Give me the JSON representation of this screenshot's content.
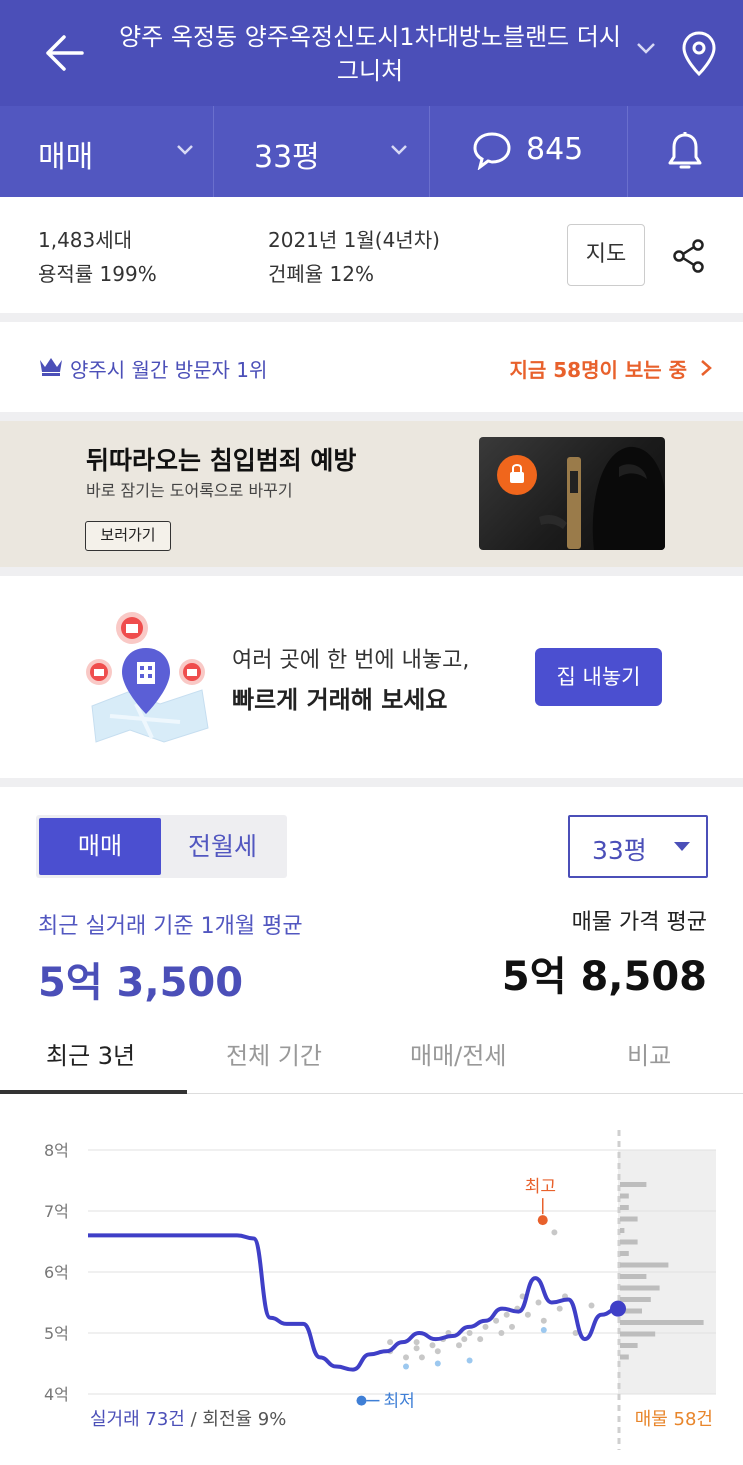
{
  "header": {
    "title": "양주 옥정동 양주옥정신도시1차대방노블랜드 더시그니처",
    "back_icon": "arrow-left-icon",
    "location_icon": "map-pin-icon"
  },
  "subbar": {
    "deal_type": "매매",
    "size": "33평",
    "comments_count": "845",
    "bell_icon": "bell-icon"
  },
  "info": {
    "households": "1,483세대",
    "far": "용적률 199%",
    "completion": "2021년 1월(4년차)",
    "bcr": "건폐율 12%",
    "map_button": "지도"
  },
  "visitor": {
    "rank_text": "양주시 월간 방문자 1위",
    "live_text": "지금 58명이 보는 중"
  },
  "ad": {
    "title": "뒤따라오는 침입범죄 예방",
    "subtitle": "바로 잠기는 도어록으로 바꾸기",
    "button": "보러가기"
  },
  "promo": {
    "line1": "여러 곳에 한 번에 내놓고,",
    "line2": "빠르게 거래해 보세요",
    "button": "집 내놓기"
  },
  "price": {
    "toggle_on": "매매",
    "toggle_off": "전월세",
    "size_select": "33평",
    "avg_label": "최근 실거래 기준 1개월 평균",
    "avg_value": "5억 3,500",
    "ask_label": "매물 가격 평균",
    "ask_value": "5억 8,508"
  },
  "tabs": [
    "최근 3년",
    "전체 기간",
    "매매/전세",
    "비교"
  ],
  "chart_data": {
    "type": "line",
    "y_ticks": [
      "8억",
      "7억",
      "6억",
      "5억",
      "4억"
    ],
    "ylim": [
      4,
      8
    ],
    "y_unit": "억",
    "line": [
      6.6,
      6.6,
      6.6,
      6.6,
      6.6,
      6.6,
      6.6,
      6.6,
      6.6,
      6.6,
      6.55,
      5.25,
      5.15,
      5.15,
      4.6,
      4.45,
      4.4,
      4.65,
      4.7,
      4.85,
      5.0,
      4.9,
      4.95,
      5.1,
      5.2,
      5.4,
      5.35,
      5.9,
      5.5,
      5.55,
      4.9,
      5.3,
      5.4
    ],
    "scatter": [
      [
        0.57,
        4.85
      ],
      [
        0.57,
        4.7
      ],
      [
        0.6,
        4.6
      ],
      [
        0.62,
        4.85
      ],
      [
        0.62,
        4.75
      ],
      [
        0.63,
        4.6
      ],
      [
        0.65,
        4.8
      ],
      [
        0.66,
        4.7
      ],
      [
        0.67,
        4.9
      ],
      [
        0.68,
        5.0
      ],
      [
        0.7,
        4.8
      ],
      [
        0.71,
        4.9
      ],
      [
        0.72,
        5.0
      ],
      [
        0.74,
        4.9
      ],
      [
        0.75,
        5.1
      ],
      [
        0.77,
        5.2
      ],
      [
        0.78,
        5.0
      ],
      [
        0.79,
        5.3
      ],
      [
        0.8,
        5.1
      ],
      [
        0.81,
        5.4
      ],
      [
        0.82,
        5.6
      ],
      [
        0.83,
        5.3
      ],
      [
        0.85,
        5.5
      ],
      [
        0.86,
        5.2
      ],
      [
        0.88,
        6.65
      ],
      [
        0.89,
        5.4
      ],
      [
        0.9,
        5.6
      ],
      [
        0.92,
        5.0
      ],
      [
        0.95,
        5.45
      ]
    ],
    "max_label": "최고",
    "max_value": 6.85,
    "min_label": "최저",
    "min_value": 4.35,
    "listing_histogram": [
      0.3,
      0.1,
      0.1,
      0.2,
      0.05,
      0.2,
      0.1,
      0.55,
      0.3,
      0.45,
      0.35,
      0.25,
      0.95,
      0.4,
      0.2,
      0.1
    ],
    "footer_left_main": "실거래 73건",
    "footer_left_rest": " / 회전율 9%",
    "footer_right": "매물 58건"
  }
}
